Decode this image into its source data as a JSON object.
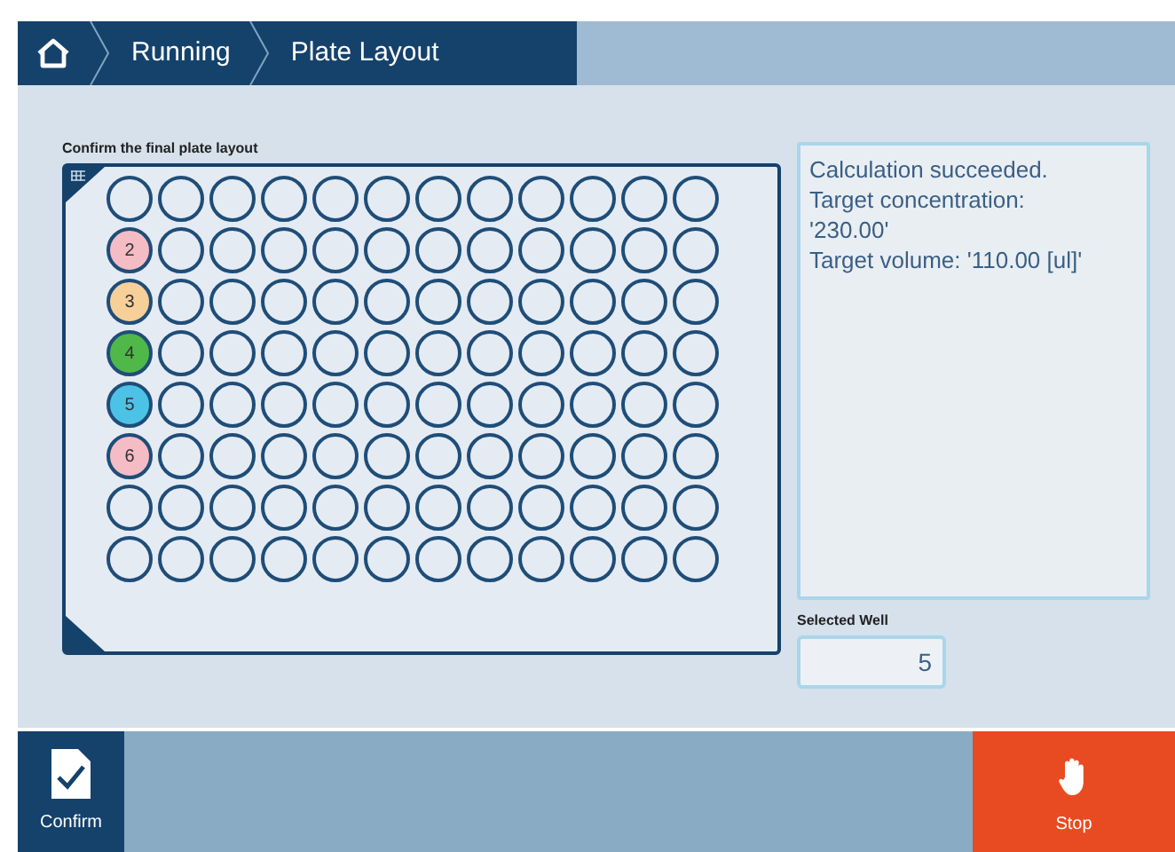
{
  "breadcrumb": [
    {
      "kind": "home"
    },
    {
      "kind": "text",
      "label": "Running"
    },
    {
      "kind": "text",
      "label": "Plate Layout"
    }
  ],
  "plate": {
    "title": "Confirm the final plate layout",
    "rows": [
      {
        "wells": [
          {
            "kind": "empty"
          },
          {
            "kind": "empty"
          },
          {
            "kind": "empty"
          },
          {
            "kind": "empty"
          },
          {
            "kind": "empty"
          },
          {
            "kind": "empty"
          },
          {
            "kind": "empty"
          },
          {
            "kind": "empty"
          },
          {
            "kind": "empty"
          },
          {
            "kind": "empty"
          },
          {
            "kind": "empty"
          },
          {
            "kind": "empty"
          }
        ]
      },
      {
        "wells": [
          {
            "kind": "sample",
            "label": "2",
            "color": "#f4bcc4"
          },
          {
            "kind": "empty"
          },
          {
            "kind": "empty"
          },
          {
            "kind": "empty"
          },
          {
            "kind": "empty"
          },
          {
            "kind": "empty"
          },
          {
            "kind": "empty"
          },
          {
            "kind": "empty"
          },
          {
            "kind": "empty"
          },
          {
            "kind": "empty"
          },
          {
            "kind": "empty"
          },
          {
            "kind": "empty"
          }
        ]
      },
      {
        "wells": [
          {
            "kind": "sample",
            "label": "3",
            "color": "#f7cf98"
          },
          {
            "kind": "empty"
          },
          {
            "kind": "empty"
          },
          {
            "kind": "empty"
          },
          {
            "kind": "empty"
          },
          {
            "kind": "empty"
          },
          {
            "kind": "empty"
          },
          {
            "kind": "empty"
          },
          {
            "kind": "empty"
          },
          {
            "kind": "empty"
          },
          {
            "kind": "empty"
          },
          {
            "kind": "empty"
          }
        ]
      },
      {
        "wells": [
          {
            "kind": "sample",
            "label": "4",
            "color": "#4fb848"
          },
          {
            "kind": "empty"
          },
          {
            "kind": "empty"
          },
          {
            "kind": "empty"
          },
          {
            "kind": "empty"
          },
          {
            "kind": "empty"
          },
          {
            "kind": "empty"
          },
          {
            "kind": "empty"
          },
          {
            "kind": "empty"
          },
          {
            "kind": "empty"
          },
          {
            "kind": "empty"
          },
          {
            "kind": "empty"
          }
        ]
      },
      {
        "wells": [
          {
            "kind": "sample",
            "label": "5",
            "color": "#4cc3e6"
          },
          {
            "kind": "empty"
          },
          {
            "kind": "empty"
          },
          {
            "kind": "empty"
          },
          {
            "kind": "empty"
          },
          {
            "kind": "empty"
          },
          {
            "kind": "empty"
          },
          {
            "kind": "empty"
          },
          {
            "kind": "empty"
          },
          {
            "kind": "empty"
          },
          {
            "kind": "empty"
          },
          {
            "kind": "empty"
          }
        ]
      },
      {
        "wells": [
          {
            "kind": "sample",
            "label": "6",
            "color": "#f4bcc4"
          },
          {
            "kind": "empty"
          },
          {
            "kind": "empty"
          },
          {
            "kind": "empty"
          },
          {
            "kind": "empty"
          },
          {
            "kind": "empty"
          },
          {
            "kind": "empty"
          },
          {
            "kind": "empty"
          },
          {
            "kind": "empty"
          },
          {
            "kind": "empty"
          },
          {
            "kind": "empty"
          },
          {
            "kind": "empty"
          }
        ]
      },
      {
        "wells": [
          {
            "kind": "empty"
          },
          {
            "kind": "empty"
          },
          {
            "kind": "empty"
          },
          {
            "kind": "empty"
          },
          {
            "kind": "empty"
          },
          {
            "kind": "empty"
          },
          {
            "kind": "empty"
          },
          {
            "kind": "empty"
          },
          {
            "kind": "empty"
          },
          {
            "kind": "empty"
          },
          {
            "kind": "empty"
          },
          {
            "kind": "empty"
          }
        ]
      },
      {
        "wells": [
          {
            "kind": "empty"
          },
          {
            "kind": "empty"
          },
          {
            "kind": "empty"
          },
          {
            "kind": "empty"
          },
          {
            "kind": "empty"
          },
          {
            "kind": "empty"
          },
          {
            "kind": "empty"
          },
          {
            "kind": "empty"
          },
          {
            "kind": "empty"
          },
          {
            "kind": "empty"
          },
          {
            "kind": "empty"
          },
          {
            "kind": "empty"
          }
        ]
      }
    ]
  },
  "message": [
    "Calculation succeeded.",
    "Target concentration:",
    "'230.00'",
    "Target volume: '110.00 [ul]'"
  ],
  "selected_well": {
    "label": "Selected Well",
    "value": "5"
  },
  "actions": [
    {
      "kind": "confirm",
      "label": "Confirm"
    },
    {
      "kind": "stop",
      "label": "Stop"
    }
  ]
}
